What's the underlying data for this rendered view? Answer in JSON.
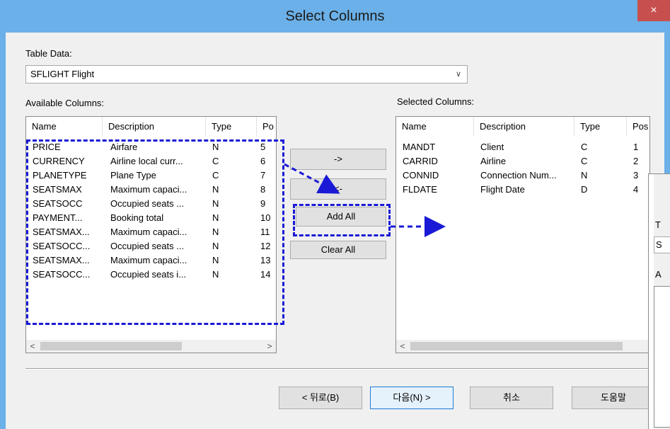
{
  "window": {
    "title": "Select Columns",
    "close_glyph": "×"
  },
  "table_data": {
    "label": "Table Data:",
    "selected": "SFLIGHT Flight",
    "dropdown_glyph": "∨"
  },
  "available": {
    "label": "Available Columns:",
    "headers": [
      "Name",
      "Description",
      "Type",
      "Po"
    ],
    "rows": [
      [
        "PRICE",
        "Airfare",
        "N",
        "5"
      ],
      [
        "CURRENCY",
        "Airline local curr...",
        "C",
        "6"
      ],
      [
        "PLANETYPE",
        "Plane Type",
        "C",
        "7"
      ],
      [
        "SEATSMAX",
        "Maximum capaci...",
        "N",
        "8"
      ],
      [
        "SEATSOCC",
        "Occupied seats ...",
        "N",
        "9"
      ],
      [
        "PAYMENT...",
        "Booking total",
        "N",
        "10"
      ],
      [
        "SEATSMAX...",
        "Maximum capaci...",
        "N",
        "11"
      ],
      [
        "SEATSOCC...",
        "Occupied seats ...",
        "N",
        "12"
      ],
      [
        "SEATSMAX...",
        "Maximum capaci...",
        "N",
        "13"
      ],
      [
        "SEATSOCC...",
        "Occupied seats i...",
        "N",
        "14"
      ]
    ]
  },
  "selected": {
    "label": "Selected Columns:",
    "headers": [
      "Name",
      "Description",
      "Type",
      "Pos"
    ],
    "rows": [
      [
        "MANDT",
        "Client",
        "C",
        "1"
      ],
      [
        "CARRID",
        "Airline",
        "C",
        "2"
      ],
      [
        "CONNID",
        "Connection Num...",
        "N",
        "3"
      ],
      [
        "FLDATE",
        "Flight Date",
        "D",
        "4"
      ]
    ]
  },
  "middle_buttons": {
    "add": "->",
    "remove": "<-",
    "add_all": "Add All",
    "clear_all": "Clear All"
  },
  "footer": {
    "back": "< 뒤로(B)",
    "next": "다음(N) >",
    "cancel": "취소",
    "help": "도움말"
  },
  "scroll": {
    "left_glyph": "<",
    "right_glyph": ">"
  },
  "overlay_dialog": {
    "partial_labels": [
      "T",
      "S",
      "A"
    ]
  },
  "colors": {
    "titlebar": "#6bb0e8",
    "close": "#c7504f",
    "annotation": "#1a1ad6"
  }
}
